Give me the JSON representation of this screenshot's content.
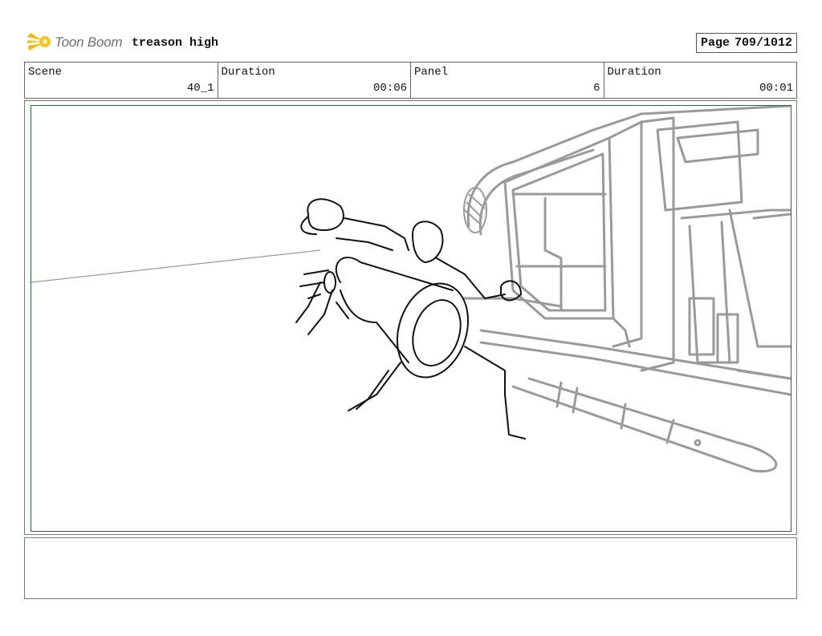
{
  "header": {
    "logo_text": "Toon Boom",
    "project_title": "treason high",
    "page_label": "Page",
    "page_value": "709/1012"
  },
  "info": {
    "scene_label": "Scene",
    "scene_value": "40_1",
    "duration_label": "Duration",
    "duration_value": "00:06",
    "panel_label": "Panel",
    "panel_value": "6",
    "panel_duration_label": "Duration",
    "panel_duration_value": "00:01"
  },
  "notes": {
    "text": ""
  },
  "colors": {
    "frame_green": "#2e6b2e",
    "sketch_black": "#111111",
    "background_gray": "#9a9a9a",
    "logo_yellow": "#f2b705"
  }
}
